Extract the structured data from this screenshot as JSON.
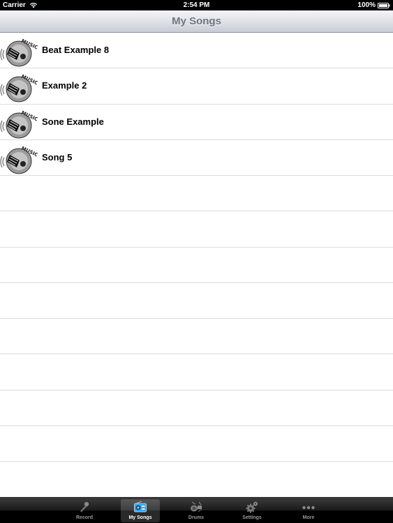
{
  "status_bar": {
    "carrier": "Carrier",
    "time": "2:54 PM",
    "battery": "100%"
  },
  "nav_bar": {
    "title": "My Songs"
  },
  "songs": [
    {
      "title": "Beat Example 8",
      "icon": "music-guitar-icon"
    },
    {
      "title": "Example 2",
      "icon": "music-guitar-icon"
    },
    {
      "title": "Sone Example",
      "icon": "music-guitar-icon"
    },
    {
      "title": "Song 5",
      "icon": "music-guitar-icon"
    }
  ],
  "tab_bar": {
    "selected": "My Songs",
    "tabs": [
      {
        "label": "Record",
        "icon": "microphone-icon"
      },
      {
        "label": "My Songs",
        "icon": "radio-icon"
      },
      {
        "label": "Drums",
        "icon": "drums-icon"
      },
      {
        "label": "Settings",
        "icon": "gears-icon"
      },
      {
        "label": "More",
        "icon": "more-dots-icon"
      }
    ]
  },
  "colors": {
    "nav_title": "#6d7381",
    "row_separator": "#dcdcdc",
    "tab_label": "#9a9a9a",
    "tab_label_selected": "#ffffff"
  }
}
